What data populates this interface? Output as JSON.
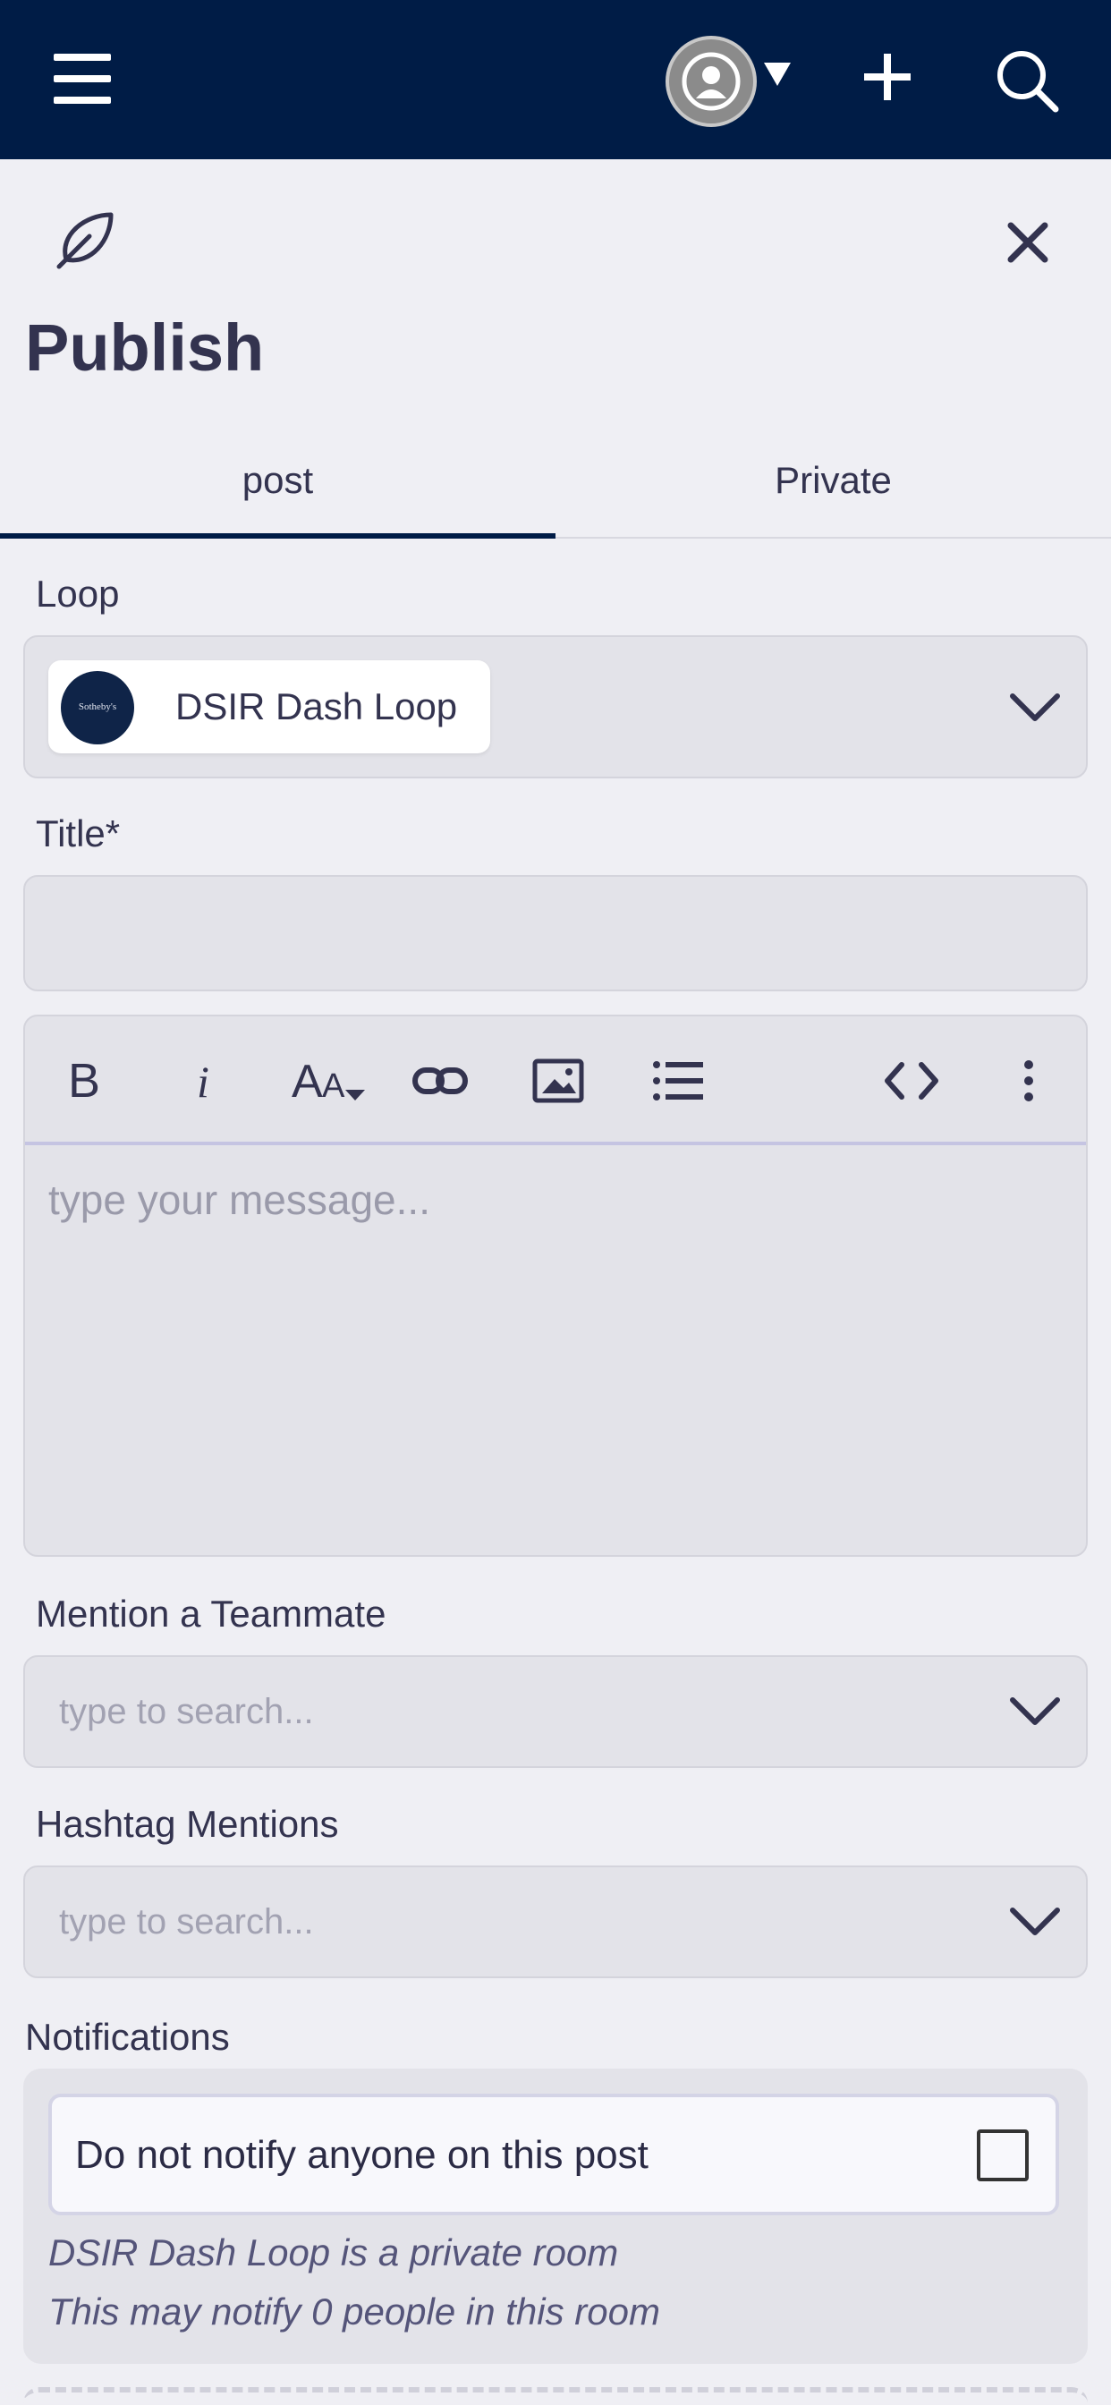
{
  "header": {
    "menu_icon": "hamburger-icon",
    "avatar_icon": "user-avatar-icon",
    "add_icon": "plus-icon",
    "search_icon": "search-icon",
    "background_color": "#001c46"
  },
  "compose": {
    "icon": "feather-icon",
    "close_icon": "close-icon",
    "title": "Publish"
  },
  "tabs": [
    {
      "label": "post",
      "active": true
    },
    {
      "label": "Private",
      "active": false
    }
  ],
  "loop": {
    "label": "Loop",
    "selected": "DSIR Dash Loop",
    "logo_text": "Sotheby's"
  },
  "title_field": {
    "label": "Title*",
    "value": ""
  },
  "editor": {
    "toolbar": [
      "bold-icon",
      "italic-icon",
      "font-size-icon",
      "link-icon",
      "image-icon",
      "list-icon",
      "code-icon",
      "more-icon"
    ],
    "placeholder": "type your message..."
  },
  "mention": {
    "label": "Mention a Teammate",
    "placeholder": "type to search..."
  },
  "hashtag": {
    "label": "Hashtag Mentions",
    "placeholder": "type to search..."
  },
  "notifications": {
    "label": "Notifications",
    "option_label": "Do not notify anyone on this post",
    "checked": false,
    "note_room": "DSIR Dash Loop is a private room",
    "note_count": "This may notify 0 people in this room"
  }
}
